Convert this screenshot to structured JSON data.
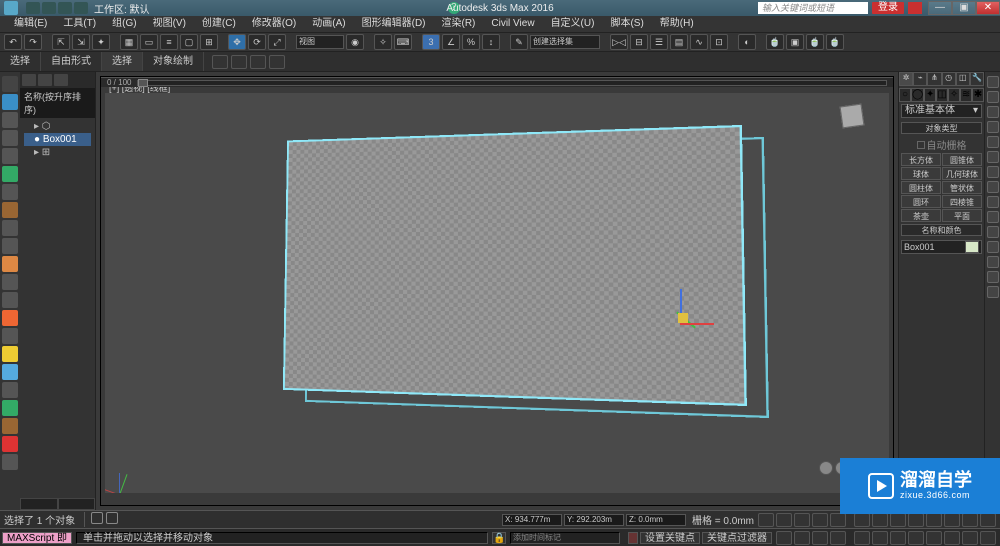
{
  "titlebar": {
    "workspace": "工作区: 默认",
    "title": "Autodesk 3ds Max 2016",
    "search_placeholder": "输入关键词或短语",
    "login": "登录",
    "help": "?",
    "min": "—",
    "max": "▣",
    "close": "✕"
  },
  "menu": {
    "items": [
      "编辑(E)",
      "工具(T)",
      "组(G)",
      "视图(V)",
      "创建(C)",
      "修改器(O)",
      "动画(A)",
      "图形编辑器(D)",
      "渲染(R)",
      "Civil View",
      "自定义(U)",
      "脚本(S)",
      "帮助(H)"
    ]
  },
  "toolbar": {
    "view_drop": "视图",
    "create_drop": "创建选择集"
  },
  "ribbon": {
    "tabs": [
      "选择",
      "自由形式",
      "选择",
      "对象绘制"
    ]
  },
  "scene": {
    "header": "名称(按升序排序)",
    "root": "Box001",
    "group_icon": "▸"
  },
  "viewport": {
    "label": "[+] [透视] [线框]"
  },
  "timeline": {
    "range": "0 / 100"
  },
  "rightpanel": {
    "dropdown": "标准基本体",
    "rollout_type": "对象类型",
    "auto_grid": "自动栅格",
    "buttons": [
      "长方体",
      "圆锥体",
      "球体",
      "几何球体",
      "圆柱体",
      "管状体",
      "圆环",
      "四棱锥",
      "茶壶",
      "平面"
    ],
    "rollout_name": "名称和颜色",
    "name_value": "Box001",
    "chevron": "▾"
  },
  "status1": {
    "selection": "选择了 1 个对象",
    "x": "X: 934.777m",
    "y": "Y: 292.203m",
    "z": "Z: 0.0mm",
    "grid_label": "栅格 = 0.0mm"
  },
  "status2": {
    "script": "MAXScript 即",
    "hint": "单击并拖动以选择并移动对象",
    "lock_icon": "🔒",
    "add_time_mark": "添加时间标记",
    "set_key": "设置关键点",
    "key_filter": "关键点过滤器"
  },
  "watermark": {
    "cn": "溜溜自学",
    "en": "zixue.3d66.com"
  }
}
